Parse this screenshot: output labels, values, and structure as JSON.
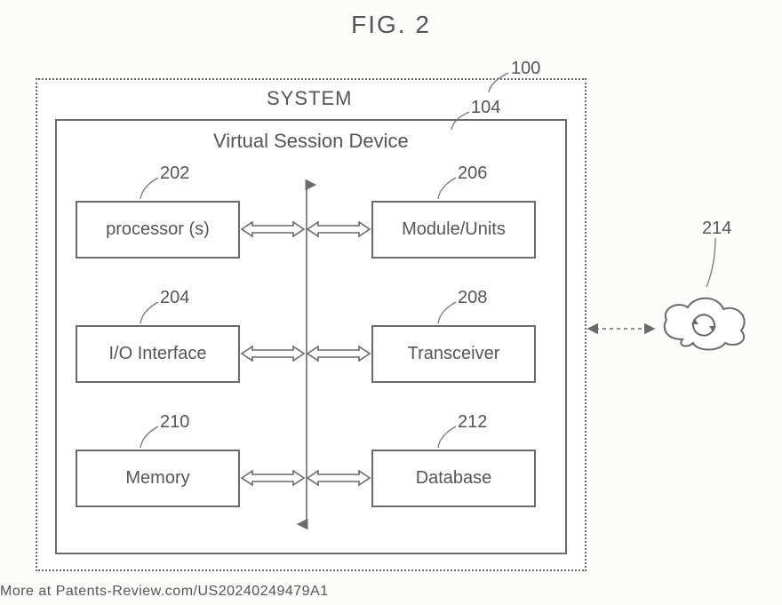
{
  "figure_title": "FIG. 2",
  "system": {
    "label": "SYSTEM",
    "ref": "100"
  },
  "inner": {
    "title": "Virtual Session Device",
    "ref": "104"
  },
  "components": {
    "processor": {
      "label": "processor (s)",
      "ref": "202"
    },
    "module": {
      "label": "Module/Units",
      "ref": "206"
    },
    "io": {
      "label": "I/O Interface",
      "ref": "204"
    },
    "transceiver": {
      "label": "Transceiver",
      "ref": "208"
    },
    "memory": {
      "label": "Memory",
      "ref": "210"
    },
    "database": {
      "label": "Database",
      "ref": "212"
    }
  },
  "cloud": {
    "ref": "214",
    "icon": "cloud-sync-icon"
  },
  "watermark": "More at Patents-Review.com/US20240249479A1"
}
